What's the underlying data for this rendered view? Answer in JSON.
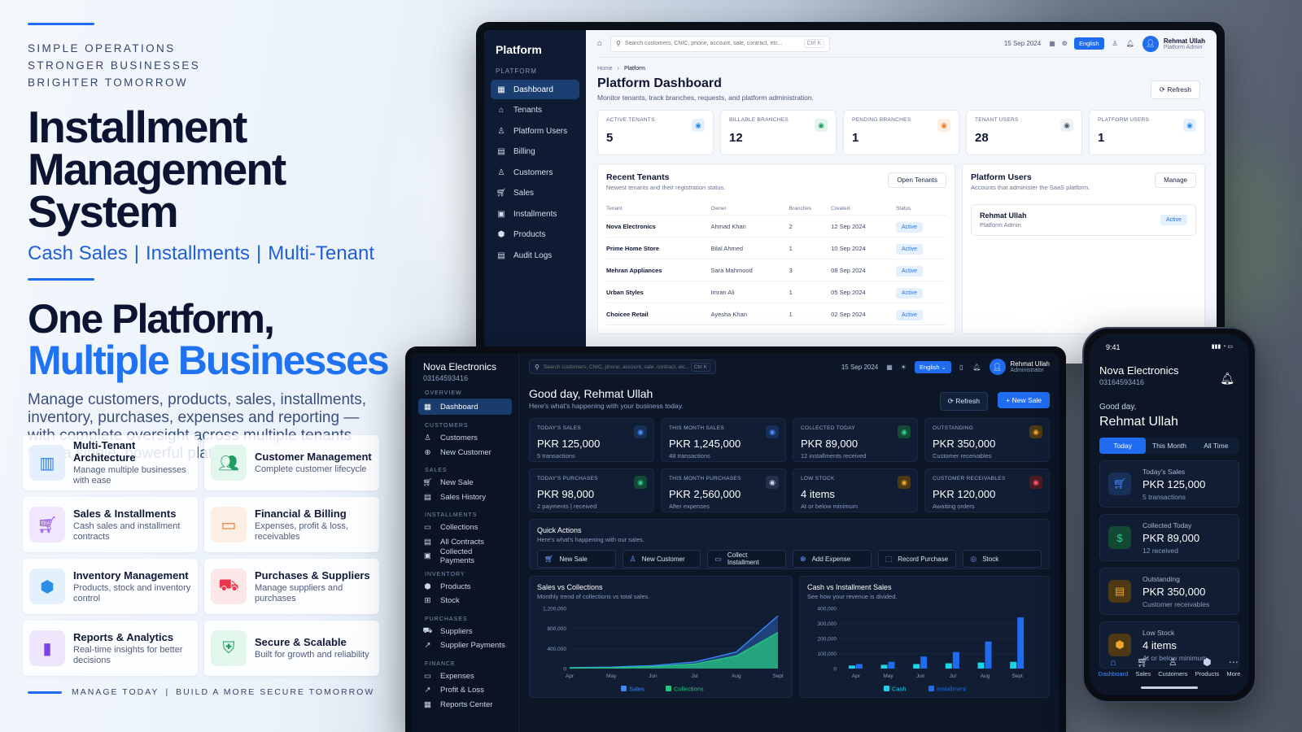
{
  "marketing": {
    "taglines": [
      "SIMPLE OPERATIONS",
      "STRONGER BUSINESSES",
      "BRIGHTER TOMORROW"
    ],
    "title_line1": "Installment",
    "title_line2": "Management System",
    "subtitle_parts": [
      "Cash Sales",
      "Installments",
      "Multi-Tenant"
    ],
    "headline_line1": "One Platform,",
    "headline_line2": "Multiple Businesses",
    "description": "Manage customers, products, sales, installments, inventory, purchases, expenses and reporting — with complete oversight across multiple tenants from a single, powerful platform.",
    "features": [
      {
        "title": "Multi-Tenant Architecture",
        "desc": "Manage multiple businesses with ease",
        "icon": "building-icon",
        "color": "#2a7de8",
        "bg": "#e6f0fd"
      },
      {
        "title": "Customer Management",
        "desc": "Complete customer lifecycle",
        "icon": "users-icon",
        "color": "#1e9e62",
        "bg": "#e3f6ec"
      },
      {
        "title": "Sales & Installments",
        "desc": "Cash sales and installment contracts",
        "icon": "cart-icon",
        "color": "#8a3fe0",
        "bg": "#f0e7fc"
      },
      {
        "title": "Financial & Billing",
        "desc": "Expenses, profit & loss, receivables",
        "icon": "card-icon",
        "color": "#f07a2a",
        "bg": "#fdeee3"
      },
      {
        "title": "Inventory Management",
        "desc": "Products, stock and inventory control",
        "icon": "box-icon",
        "color": "#2a8ee8",
        "bg": "#e4f1fd"
      },
      {
        "title": "Purchases & Suppliers",
        "desc": "Manage suppliers and purchases",
        "icon": "truck-icon",
        "color": "#e8364a",
        "bg": "#fde6e8"
      },
      {
        "title": "Reports & Analytics",
        "desc": "Real-time insights for better decisions",
        "icon": "bar-chart-icon",
        "color": "#7a45e0",
        "bg": "#eee7fc"
      },
      {
        "title": "Secure & Scalable",
        "desc": "Built for growth and reliability",
        "icon": "shield-icon",
        "color": "#1e9e62",
        "bg": "#e3f6ec"
      }
    ],
    "footer_left": "MANAGE TODAY",
    "footer_right": "BUILD A MORE SECURE TOMORROW"
  },
  "monitor": {
    "brand": "Platform",
    "section": "PLATFORM",
    "nav": [
      "Dashboard",
      "Tenants",
      "Platform Users",
      "Billing",
      "Customers",
      "Sales",
      "Installments",
      "Products",
      "Audit Logs"
    ],
    "search_placeholder": "Search customers, CNIC, phone, account, sale, contract, etc...",
    "kbd": "Ctrl K",
    "date": "15 Sep 2024",
    "lang": "English",
    "user_name": "Rehmat Ullah",
    "user_role": "Platform Admin",
    "crumb_home": "Home",
    "crumb_current": "Platform",
    "title": "Platform Dashboard",
    "subtitle": "Monitor tenants, track branches, requests, and platform administration.",
    "refresh": "Refresh",
    "kpis": [
      {
        "label": "ACTIVE TENANTS",
        "value": "5",
        "color": "#2a8ee8",
        "bg": "#e4f1fd"
      },
      {
        "label": "BILLABLE BRANCHES",
        "value": "12",
        "color": "#1e9e62",
        "bg": "#e3f6ec"
      },
      {
        "label": "PENDING BRANCHES",
        "value": "1",
        "color": "#f07a2a",
        "bg": "#fdeee3"
      },
      {
        "label": "TENANT USERS",
        "value": "28",
        "color": "#4a5673",
        "bg": "#eef1f6"
      },
      {
        "label": "PLATFORM USERS",
        "value": "1",
        "color": "#2a8ee8",
        "bg": "#e4f1fd"
      }
    ],
    "recent": {
      "title": "Recent Tenants",
      "subtitle": "Newest tenants and their registration status.",
      "button": "Open Tenants",
      "headers": [
        "Tenant",
        "Owner",
        "Branches",
        "Created",
        "Status"
      ],
      "rows": [
        [
          "Nova Electronics",
          "Ahmad Khan",
          "2",
          "12 Sep 2024",
          "Active"
        ],
        [
          "Prime Home Store",
          "Bilal Ahmed",
          "1",
          "10 Sep 2024",
          "Active"
        ],
        [
          "Mehran Appliances",
          "Sara Mahmood",
          "3",
          "08 Sep 2024",
          "Active"
        ],
        [
          "Urban Styles",
          "Imran Ali",
          "1",
          "05 Sep 2024",
          "Active"
        ],
        [
          "Choicee Retail",
          "Ayesha Khan",
          "1",
          "02 Sep 2024",
          "Active"
        ]
      ]
    },
    "users_panel": {
      "title": "Platform Users",
      "subtitle": "Accounts that administer the SaaS platform.",
      "button": "Manage",
      "user": "Rehmat Ullah",
      "role": "Platform Admin",
      "status": "Active"
    }
  },
  "laptop": {
    "brand": "Nova Electronics",
    "phone": "03164593416",
    "sections": [
      {
        "label": "OVERVIEW",
        "items": [
          "Dashboard"
        ]
      },
      {
        "label": "CUSTOMERS",
        "items": [
          "Customers",
          "New Customer"
        ]
      },
      {
        "label": "SALES",
        "items": [
          "New Sale",
          "Sales History"
        ]
      },
      {
        "label": "INSTALLMENTS",
        "items": [
          "Collections",
          "All Contracts",
          "Collected Payments"
        ]
      },
      {
        "label": "INVENTORY",
        "items": [
          "Products",
          "Stock"
        ]
      },
      {
        "label": "PURCHASES",
        "items": [
          "Suppliers",
          "Supplier Payments"
        ]
      },
      {
        "label": "FINANCE",
        "items": [
          "Expenses",
          "Profit & Loss",
          "Reports Center"
        ]
      }
    ],
    "search_placeholder": "Search customers, CNIC, phone, account, sale, contract, etc...",
    "kbd": "Ctrl K",
    "date": "15 Sep 2024",
    "lang": "English",
    "user_name": "Rehmat Ullah",
    "user_role": "Administrator",
    "greeting": "Good day, Rehmat Ullah",
    "greeting_sub": "Here's what's happening with your business today.",
    "refresh": "Refresh",
    "new_sale": "+ New Sale",
    "kpis": [
      {
        "label": "TODAY'S SALES",
        "value": "PKR 125,000",
        "sub": "5 transactions",
        "color": "#4c8dff",
        "bg": "#16305a"
      },
      {
        "label": "THIS MONTH SALES",
        "value": "PKR 1,245,000",
        "sub": "48 transactions",
        "color": "#4c8dff",
        "bg": "#16305a"
      },
      {
        "label": "COLLECTED TODAY",
        "value": "PKR 89,000",
        "sub": "12 installments received",
        "color": "#2ecf8a",
        "bg": "#124a36"
      },
      {
        "label": "OUTSTANDING",
        "value": "PKR 350,000",
        "sub": "Customer receivables",
        "color": "#f0a62a",
        "bg": "#4d3a15"
      },
      {
        "label": "TODAY'S PURCHASES",
        "value": "PKR 98,000",
        "sub": "2 payments | received",
        "color": "#2ecf8a",
        "bg": "#124a36"
      },
      {
        "label": "THIS MONTH PURCHASES",
        "value": "PKR 2,560,000",
        "sub": "After expenses",
        "color": "#cbd6ea",
        "bg": "#25314a"
      },
      {
        "label": "LOW STOCK",
        "value": "4 items",
        "sub": "At or below minimum",
        "color": "#f0a62a",
        "bg": "#4d3a15"
      },
      {
        "label": "CUSTOMER RECEIVABLES",
        "value": "PKR 120,000",
        "sub": "Awaiting orders",
        "color": "#ff5a6a",
        "bg": "#4d1a24"
      }
    ],
    "quick": {
      "title": "Quick Actions",
      "subtitle": "Here's what's happening with our sales.",
      "buttons": [
        "New Sale",
        "New Customer",
        "Collect Installment",
        "Add Expense",
        "Record Purchase",
        "Stock"
      ]
    },
    "chart1_title": "Sales vs Collections",
    "chart1_sub": "Monthly trend of collections vs total sales.",
    "chart2_title": "Cash vs Installment Sales",
    "chart2_sub": "See how your revenue is divided."
  },
  "chart_data": [
    {
      "type": "area",
      "title": "Sales vs Collections",
      "categories": [
        "Apr",
        "May",
        "Jun",
        "Jul",
        "Aug",
        "Sept"
      ],
      "ylim": [
        0,
        1200000
      ],
      "yticks": [
        "0",
        "400,000",
        "800,000",
        "1,200,000"
      ],
      "series": [
        {
          "name": "Sales",
          "values": [
            20000,
            30000,
            60000,
            130000,
            330000,
            1050000
          ],
          "color": "#3a86ff"
        },
        {
          "name": "Collections",
          "values": [
            10000,
            15000,
            40000,
            90000,
            250000,
            720000
          ],
          "color": "#27c47d"
        }
      ],
      "legend": "bottom"
    },
    {
      "type": "bar",
      "title": "Cash vs Installment Sales",
      "categories": [
        "Apr",
        "May",
        "Jun",
        "Jul",
        "Aug",
        "Sept"
      ],
      "ylim": [
        0,
        400000
      ],
      "yticks": [
        "0",
        "100,000",
        "200,000",
        "300,000",
        "400,000"
      ],
      "series": [
        {
          "name": "Cash",
          "values": [
            20000,
            25000,
            30000,
            35000,
            40000,
            45000
          ],
          "color": "#1fd1e8"
        },
        {
          "name": "Installment",
          "values": [
            30000,
            45000,
            80000,
            110000,
            180000,
            340000
          ],
          "color": "#1f6cf0"
        }
      ],
      "legend": "bottom"
    }
  ],
  "phone": {
    "time": "9:41",
    "status_icons": "▮▮▮ ◔ ▭",
    "brand": "Nova Electronics",
    "phone": "03164593416",
    "greet": "Good day,",
    "name": "Rehmat Ullah",
    "tabs": [
      "Today",
      "This Month",
      "All Time"
    ],
    "cards": [
      {
        "label": "Today's Sales",
        "value": "PKR 125,000",
        "sub": "5 transactions",
        "color": "#4c8dff",
        "bg": "#16305a",
        "icon": "cart-icon"
      },
      {
        "label": "Collected Today",
        "value": "PKR 89,000",
        "sub": "12 received",
        "color": "#2ecf8a",
        "bg": "#124a36",
        "icon": "cash-icon"
      },
      {
        "label": "Outstanding",
        "value": "PKR 350,000",
        "sub": "Customer receivables",
        "color": "#f0a62a",
        "bg": "#4d3a15",
        "icon": "wallet-icon"
      },
      {
        "label": "Low Stock",
        "value": "4 items",
        "sub": "At or below minimum",
        "color": "#f0a62a",
        "bg": "#4d3a15",
        "icon": "box-icon"
      }
    ],
    "nav": [
      "Dashboard",
      "Sales",
      "Customers",
      "Products",
      "More"
    ]
  }
}
